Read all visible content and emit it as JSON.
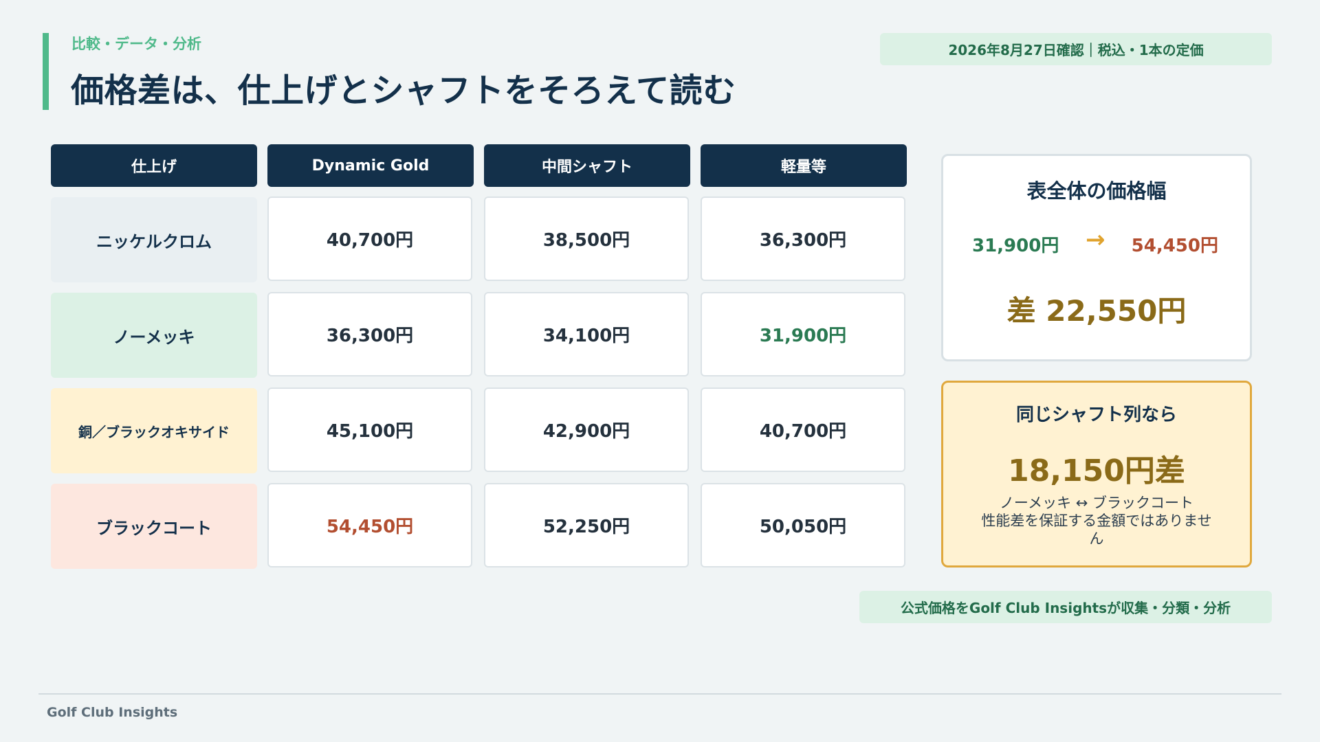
{
  "header": {
    "kicker": "比較・データ・分析",
    "title": "価格差は、仕上げとシャフトをそろえて読む",
    "date_badge": "2026年8月27日確認｜税込・1本の定価"
  },
  "table": {
    "columns": [
      "仕上げ",
      "Dynamic Gold",
      "中間シャフト",
      "軽量等"
    ],
    "rows": [
      {
        "label": "ニッケルクロム",
        "prices": [
          "40,700円",
          "38,500円",
          "36,300円"
        ]
      },
      {
        "label": "ノーメッキ",
        "prices": [
          "36,300円",
          "34,100円",
          "31,900円"
        ]
      },
      {
        "label": "銅／ブラックオキサイド",
        "prices": [
          "45,100円",
          "42,900円",
          "40,700円"
        ]
      },
      {
        "label": "ブラックコート",
        "prices": [
          "54,450円",
          "52,250円",
          "50,050円"
        ]
      }
    ],
    "row_colors": [
      "#e9eff2",
      "#dcf1e5",
      "#fff2d2",
      "#fde7df"
    ],
    "lowest_color": "#2a7a52",
    "highest_color": "#b24e30"
  },
  "range_card": {
    "title": "表全体の価格幅",
    "min": "31,900円",
    "arrow": "→",
    "max": "54,450円",
    "diff": "差 22,550円"
  },
  "same_shaft_card": {
    "title": "同じシャフト列なら",
    "value": "18,150円差",
    "line1": "ノーメッキ ↔ ブラックコート",
    "line2": "性能差を保証する金額ではありません"
  },
  "source_note": "公式価格をGolf Club Insightsが収集・分類・分析",
  "footer": {
    "brand": "Golf Club Insights"
  },
  "colors": {
    "navy": "#13304a",
    "green_accent": "#4fb98a",
    "gold": "#8a6a18",
    "orange_accent": "#e0a32e"
  }
}
